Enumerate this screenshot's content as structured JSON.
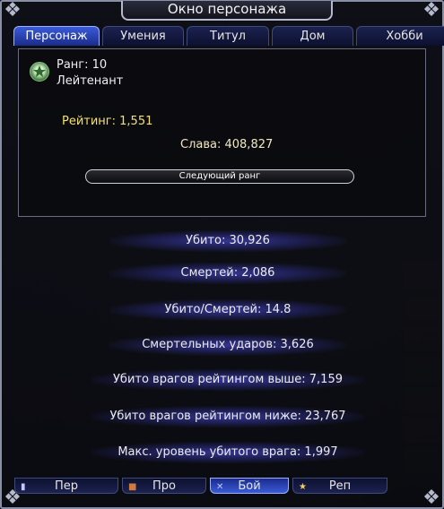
{
  "window": {
    "title": "Окно персонажа"
  },
  "tabs": [
    {
      "label": "Персонаж",
      "active": true
    },
    {
      "label": "Умения",
      "active": false
    },
    {
      "label": "Титул",
      "active": false
    },
    {
      "label": "Дом",
      "active": false
    },
    {
      "label": "Хобби",
      "active": false
    }
  ],
  "rank": {
    "label": "Ранг:",
    "value": "10",
    "title": "Лейтенант",
    "icon": "rank-emblem-icon",
    "rating": "Рейтинг: 1,551",
    "glory": "Слава: 408,827",
    "next_rank_button": "Следующий ранг"
  },
  "stats": [
    "Убито: 30,926",
    "Смертей: 2,086",
    "Убито/Смертей: 14.8",
    "Смертельных ударов: 3,626",
    "Убито врагов рейтингом выше: 7,159",
    "Убито врагов рейтингом ниже: 23,767",
    "Макс. уровень убитого врага: 1,997"
  ],
  "bottom_tabs": [
    {
      "label": "Пер",
      "icon": "scroll-icon",
      "active": false
    },
    {
      "label": "Про",
      "icon": "book-icon",
      "active": false
    },
    {
      "label": "Бой",
      "icon": "swords-icon",
      "active": true
    },
    {
      "label": "Реп",
      "icon": "star-icon",
      "active": false
    }
  ],
  "colors": {
    "active_tab": "#3a5bd8",
    "rating_text": "#f5e070",
    "stat_glow": "#3c3caa"
  }
}
